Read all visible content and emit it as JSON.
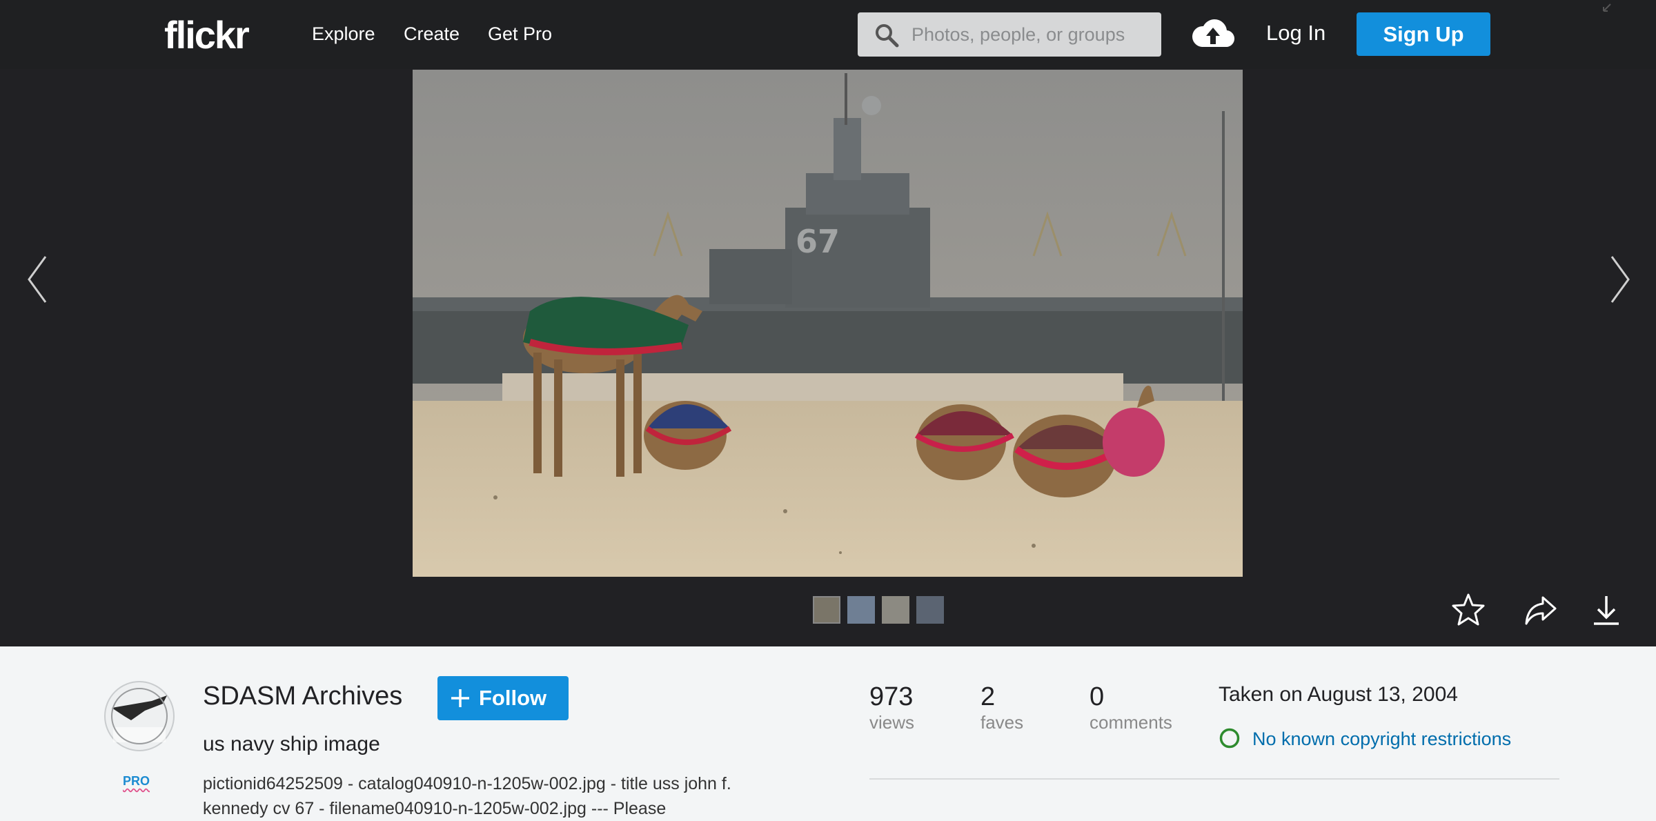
{
  "header": {
    "logo": "flickr",
    "nav": [
      "Explore",
      "Create",
      "Get Pro"
    ],
    "search": {
      "placeholder": "Photos, people, or groups",
      "icon": "search-icon"
    },
    "upload_icon": "cloud-upload-icon",
    "login_label": "Log In",
    "signup_label": "Sign Up"
  },
  "viewer": {
    "prev_icon": "chevron-left-icon",
    "next_icon": "chevron-right-icon",
    "actions": [
      "star-icon",
      "share-icon",
      "download-icon"
    ]
  },
  "info": {
    "owner": "SDASM Archives",
    "pro_badge": "PRO",
    "follow_label": "Follow",
    "title": "us navy ship image",
    "description": "pictionid64252509 - catalog040910-n-1205w-002.jpg - title uss john f. kennedy cv 67 - filename040910-n-1205w-002.jpg --- Please",
    "stats": [
      {
        "value": "973",
        "label": "views"
      },
      {
        "value": "2",
        "label": "faves"
      },
      {
        "value": "0",
        "label": "comments"
      }
    ],
    "taken": "Taken on August 13, 2004",
    "license": "No known copyright restrictions"
  },
  "colors": {
    "header_bg": "#1f2022",
    "viewer_bg": "#212124",
    "accent_blue": "#128fdc",
    "link_blue": "#006dac",
    "license_green": "#2e8b2e",
    "info_bg": "#f3f5f6"
  }
}
